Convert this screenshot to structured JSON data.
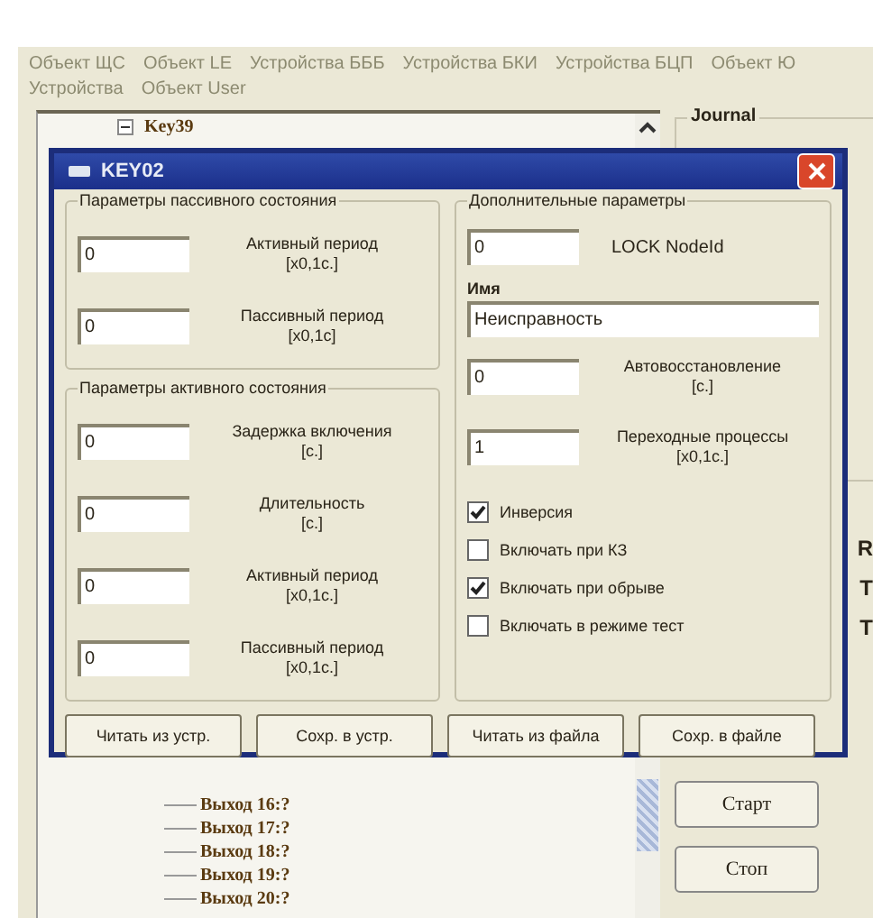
{
  "menu_rows": [
    [
      "Объект ЩС",
      "Объект LE",
      "Устройства БББ",
      "Устройства БКИ",
      "Устройства БЦП",
      "Объект Ю"
    ],
    [
      "Устройства",
      "Объект User"
    ]
  ],
  "tree": {
    "top_item": "Key39",
    "items": [
      "Выход 16:?",
      "Выход 17:?",
      "Выход 18:?",
      "Выход 19:?",
      "Выход 20:?"
    ]
  },
  "journal": {
    "title": "Journal",
    "side_letters": [
      "R",
      "T",
      "T"
    ]
  },
  "side_buttons": [
    "Старт",
    "Стоп"
  ],
  "dialog": {
    "title": "KEY02",
    "left_groups": [
      {
        "title": "Параметры пассивного состояния",
        "fields": [
          {
            "value": "0",
            "label": "Активный период",
            "unit": "[x0,1с.]"
          },
          {
            "value": "0",
            "label": "Пассивный период",
            "unit": "[x0,1с]"
          }
        ]
      },
      {
        "title": "Параметры активного состояния",
        "fields": [
          {
            "value": "0",
            "label": "Задержка включения",
            "unit": "[с.]"
          },
          {
            "value": "0",
            "label": "Длительность",
            "unit": "[с.]"
          },
          {
            "value": "0",
            "label": "Активный период",
            "unit": "[x0,1с.]"
          },
          {
            "value": "0",
            "label": "Пассивный период",
            "unit": "[x0,1с.]"
          }
        ]
      }
    ],
    "right_group": {
      "title": "Дополнительные параметры",
      "node_id": {
        "value": "0",
        "label": "LOCK NodeId"
      },
      "name": {
        "label": "Имя",
        "value": "Неисправность"
      },
      "fields": [
        {
          "value": "0",
          "label": "Автовосстановление",
          "unit": "[с.]"
        },
        {
          "value": "1",
          "label": "Переходные процессы",
          "unit": "[x0,1с.]"
        }
      ],
      "checkboxes": [
        {
          "label": "Инверсия",
          "checked": true
        },
        {
          "label": "Включать при КЗ",
          "checked": false
        },
        {
          "label": "Включать при обрыве",
          "checked": true
        },
        {
          "label": "Включать в режиме тест",
          "checked": false
        }
      ]
    },
    "buttons": [
      "Читать из устр.",
      "Сохр. в устр.",
      "Читать из файла",
      "Сохр. в файле"
    ]
  }
}
